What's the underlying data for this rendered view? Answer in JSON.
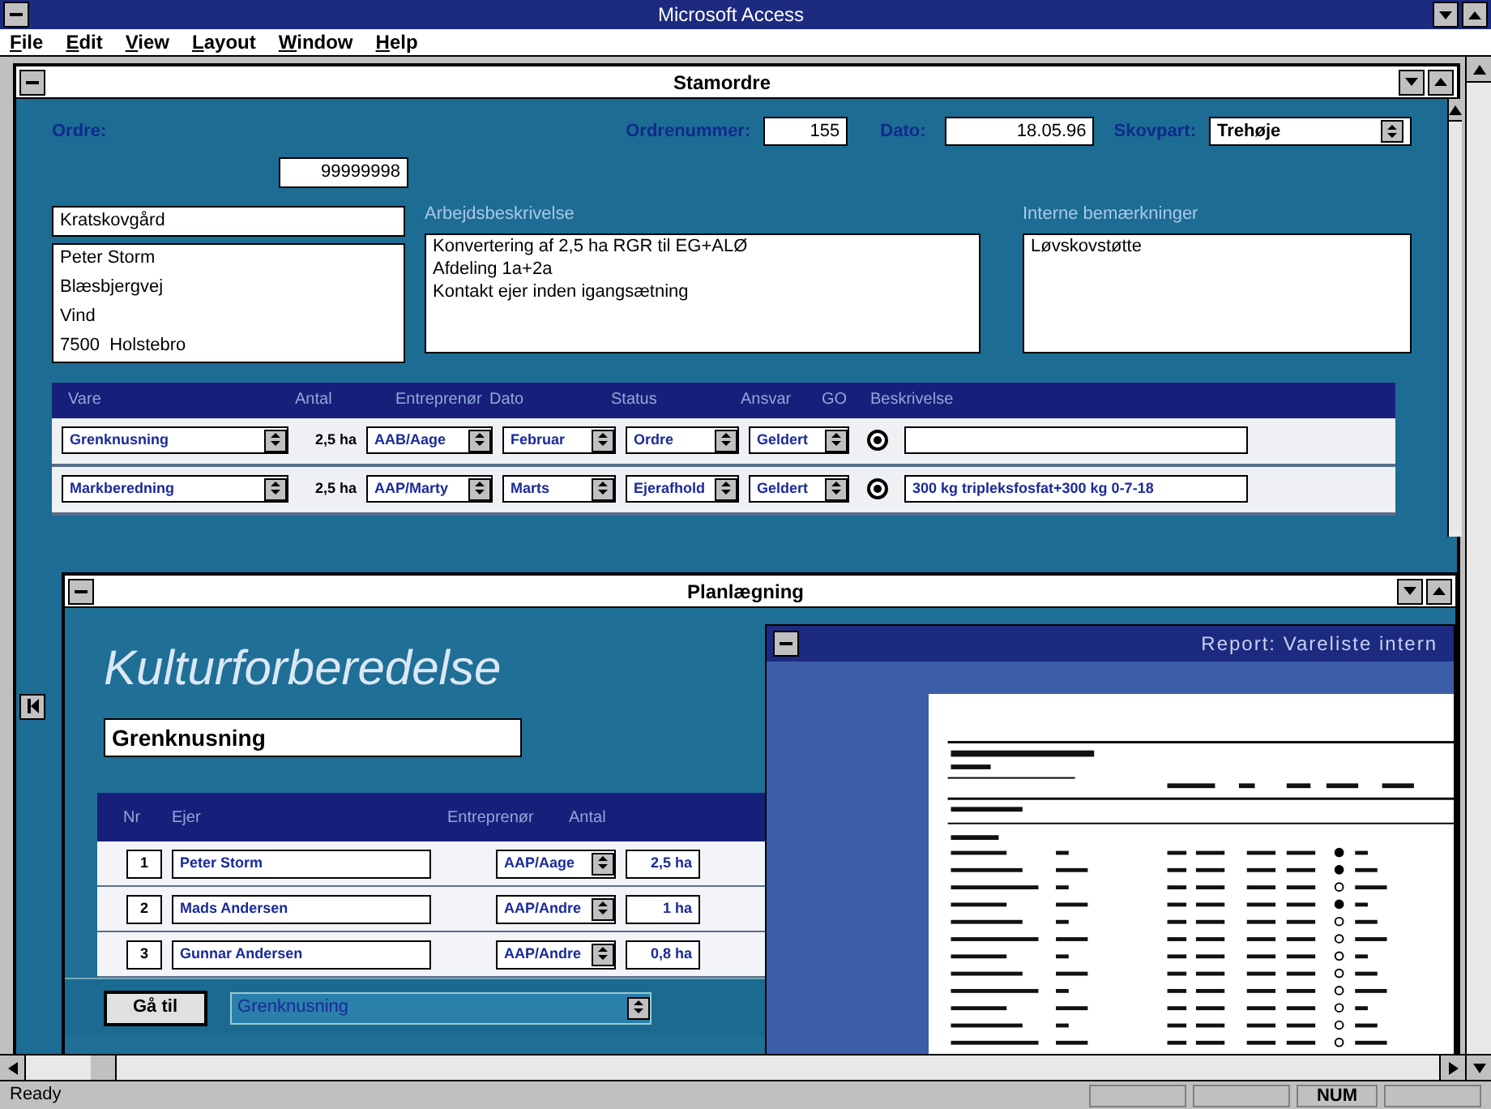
{
  "app": {
    "title": "Microsoft Access",
    "menu": [
      "File",
      "Edit",
      "View",
      "Layout",
      "Window",
      "Help"
    ],
    "status": "Ready",
    "indicators": [
      "NUM"
    ]
  },
  "stamordre": {
    "title": "Stamordre",
    "order_label": "Ordre:",
    "order_no_label": "Ordrenummer:",
    "order_no": "155",
    "date_label": "Dato:",
    "date": "18.05.96",
    "area_label": "Skovpart:",
    "area": "Trehøje",
    "customer_no": "99999998",
    "customer_name": "Kratskovgård",
    "address": [
      "Peter Storm",
      "Blæsbjergvej",
      "Vind",
      "7500  Holstebro"
    ],
    "work_label": "Arbejdsbeskrivelse",
    "work": [
      "Konvertering af 2,5 ha RGR til EG+ALØ",
      "Afdeling 1a+2a",
      "Kontakt ejer inden igangsætning"
    ],
    "notes_label": "Interne bemærkninger",
    "notes": [
      "Løvskovstøtte"
    ],
    "columns": [
      "Vare",
      "Antal",
      "Entreprenør",
      "Dato",
      "Status",
      "Ansvar",
      "GO",
      "Beskrivelse"
    ],
    "rows": [
      {
        "vare": "Grenknusning",
        "antal": "2,5 ha",
        "entreprenor": "AAB/Aage",
        "dato": "Februar",
        "status": "Ordre",
        "ansvar": "Geldert",
        "go": true
      },
      {
        "vare": "Markberedning",
        "antal": "2,5 ha",
        "entreprenor": "AAP/Marty",
        "dato": "Marts",
        "status": "Ejerafhold",
        "ansvar": "Geldert",
        "go": true,
        "beskrivelse": "300 kg tripleksfosfat+300 kg 0-7-18"
      }
    ]
  },
  "planlaegning": {
    "title": "Planlægning",
    "heading": "Kulturforberedelse",
    "activity": "Grenknusning",
    "columns": [
      "Nr",
      "Ejer",
      "Entreprenør",
      "Antal"
    ],
    "rows": [
      {
        "nr": "1",
        "ejer": "Peter Storm",
        "entreprenor": "AAP/Aage",
        "antal": "2,5 ha"
      },
      {
        "nr": "2",
        "ejer": "Mads Andersen",
        "entreprenor": "AAP/Andre",
        "antal": "1 ha"
      },
      {
        "nr": "3",
        "ejer": "Gunnar Andersen",
        "entreprenor": "AAP/Andre",
        "antal": "0,8 ha"
      }
    ],
    "goto_button": "Gå til",
    "goto_value": "Grenknusning"
  },
  "report": {
    "title": "Report: Vareliste intern"
  }
}
